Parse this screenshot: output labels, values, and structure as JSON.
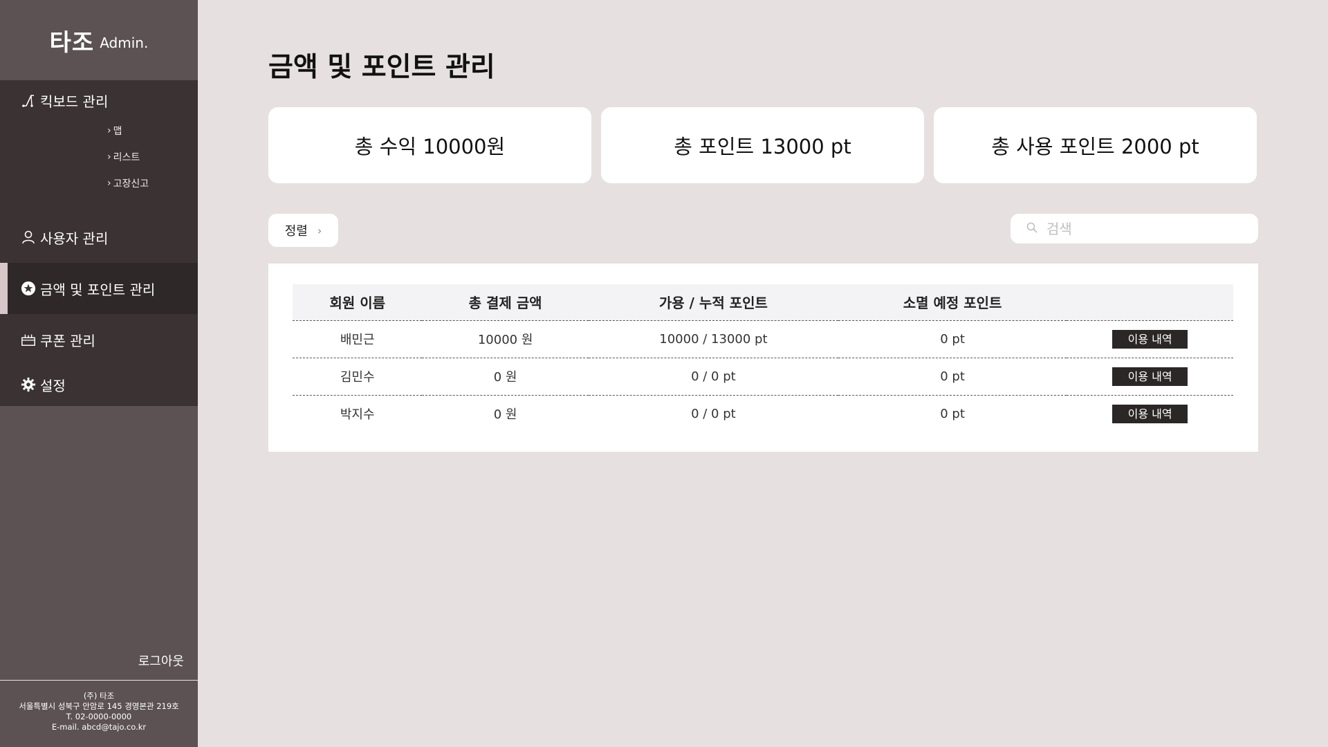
{
  "brand": {
    "name": "타조",
    "suffix": "Admin."
  },
  "nav": {
    "board": {
      "label": "킥보드 관리",
      "icon": "kickboard-icon"
    },
    "board_sub": [
      {
        "label": "맵"
      },
      {
        "label": "리스트"
      },
      {
        "label": "고장신고"
      }
    ],
    "users": {
      "label": "사용자 관리",
      "icon": "user-icon"
    },
    "money": {
      "label": "금액 및 포인트 관리",
      "icon": "star-circle-icon",
      "active": true
    },
    "coupon": {
      "label": "쿠폰 관리",
      "icon": "coupon-icon"
    },
    "settings": {
      "label": "설정",
      "icon": "gear-icon"
    }
  },
  "logout_label": "로그아웃",
  "footer": {
    "company": "(주) 타조",
    "address": "서울특별시 성북구 안암로 145 경영본관 219호",
    "phone": "T. 02-0000-0000",
    "email": "E-mail. abcd@tajo.co.kr"
  },
  "page_title": "금액 및 포인트 관리",
  "summary": {
    "revenue": "총 수익 10000원",
    "points": "총 포인트 13000 pt",
    "used_points": "총 사용 포인트 2000 pt"
  },
  "sort_label": "정렬",
  "search": {
    "placeholder": "검색",
    "value": ""
  },
  "table": {
    "headers": [
      "회원 이름",
      "총 결제 금액",
      "가용 / 누적 포인트",
      "소멸 예정 포인트",
      ""
    ],
    "rows": [
      {
        "name": "배민근",
        "payment": "10000 원",
        "points": "10000 / 13000 pt",
        "expiring": "0 pt",
        "action": "이용 내역"
      },
      {
        "name": "김민수",
        "payment": "0 원",
        "points": "0 / 0 pt",
        "expiring": "0 pt",
        "action": "이용 내역"
      },
      {
        "name": "박지수",
        "payment": "0 원",
        "points": "0 / 0 pt",
        "expiring": "0 pt",
        "action": "이용 내역"
      }
    ]
  },
  "colors": {
    "sidebar": "#5c5253",
    "nav_bg": "#3a3233",
    "active_indicator": "#d7c7c9",
    "page_bg": "#e6e0e0",
    "button_dark": "#2b2727"
  }
}
